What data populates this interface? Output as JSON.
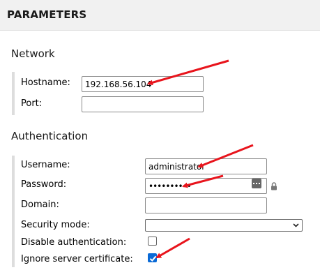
{
  "header": {
    "title": "PARAMETERS"
  },
  "network": {
    "title": "Network",
    "hostname": {
      "label": "Hostname:",
      "value": "192.168.56.104"
    },
    "port": {
      "label": "Port:",
      "value": ""
    }
  },
  "authentication": {
    "title": "Authentication",
    "username": {
      "label": "Username:",
      "value": "administrator"
    },
    "password": {
      "label": "Password:",
      "value": "••••••••••"
    },
    "domain": {
      "label": "Domain:",
      "value": ""
    },
    "security_mode": {
      "label": "Security mode:",
      "selected": ""
    },
    "disable_auth": {
      "label": "Disable authentication:",
      "checked": false
    },
    "ignore_cert": {
      "label": "Ignore server certificate:",
      "checked": true
    }
  },
  "annotation_color": "#e8141c",
  "checkbox_color": "#0a6ad6"
}
